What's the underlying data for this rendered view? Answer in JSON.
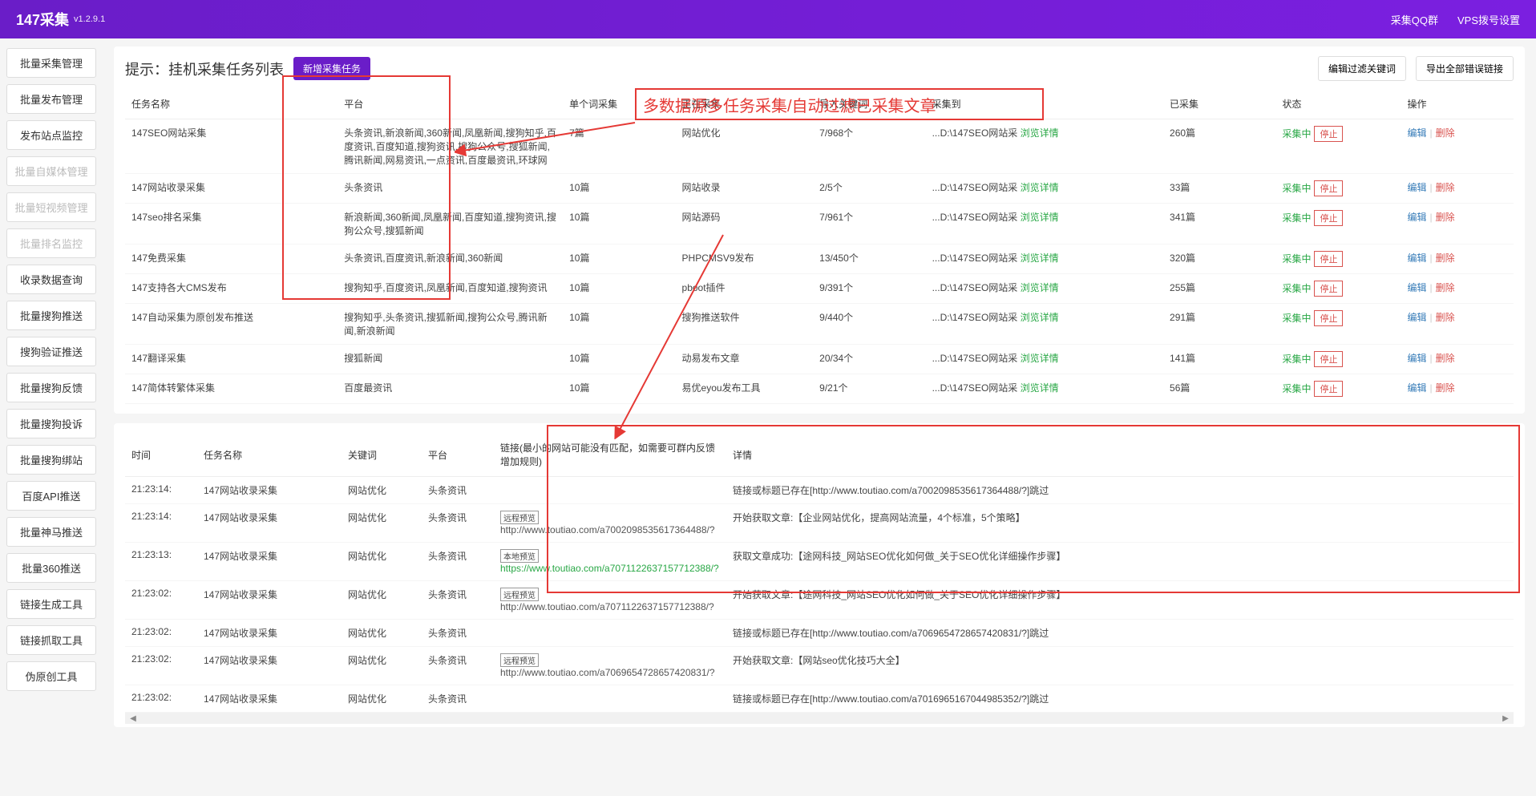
{
  "header": {
    "title": "147采集",
    "version": "v1.2.9.1",
    "links": {
      "qq": "采集QQ群",
      "vps": "VPS拨号设置"
    }
  },
  "sidebar": {
    "items": [
      {
        "label": "批量采集管理",
        "disabled": false
      },
      {
        "label": "批量发布管理",
        "disabled": false
      },
      {
        "label": "发布站点监控",
        "disabled": false
      },
      {
        "label": "批量自媒体管理",
        "disabled": true
      },
      {
        "label": "批量短视频管理",
        "disabled": true
      },
      {
        "label": "批量排名监控",
        "disabled": true
      },
      {
        "label": "收录数据查询",
        "disabled": false
      },
      {
        "label": "批量搜狗推送",
        "disabled": false
      },
      {
        "label": "搜狗验证推送",
        "disabled": false
      },
      {
        "label": "批量搜狗反馈",
        "disabled": false
      },
      {
        "label": "批量搜狗投诉",
        "disabled": false
      },
      {
        "label": "批量搜狗绑站",
        "disabled": false
      },
      {
        "label": "百度API推送",
        "disabled": false
      },
      {
        "label": "批量神马推送",
        "disabled": false
      },
      {
        "label": "批量360推送",
        "disabled": false
      },
      {
        "label": "链接生成工具",
        "disabled": false
      },
      {
        "label": "链接抓取工具",
        "disabled": false
      },
      {
        "label": "伪原创工具",
        "disabled": false
      }
    ]
  },
  "tasks": {
    "title": "提示：挂机采集任务列表",
    "add_btn": "新增采集任务",
    "filter_btn": "编辑过滤关键词",
    "export_btn": "导出全部错误链接",
    "headers": {
      "name": "任务名称",
      "platform": "平台",
      "per_word": "单个词采集",
      "collecting": "正在采集",
      "keywords": "导入关键词",
      "collect_to": "采集到",
      "collected": "已采集",
      "status": "状态",
      "action": "操作"
    },
    "detail_link": "浏览详情",
    "status_label": "采集中",
    "stop_label": "停止",
    "edit_label": "编辑",
    "delete_label": "删除",
    "rows": [
      {
        "name": "147SEO网站采集",
        "platform": "头条资讯,新浪新闻,360新闻,凤凰新闻,搜狗知乎,百度资讯,百度知道,搜狗资讯,搜狗公众号,搜狐新闻,腾讯新闻,网易资讯,一点资讯,百度最资讯,环球网",
        "per_word": "7篇",
        "collecting": "网站优化",
        "keywords": "7/968个",
        "collect_to": "...D:\\147SEO网站采",
        "collected": "260篇"
      },
      {
        "name": "147网站收录采集",
        "platform": "头条资讯",
        "per_word": "10篇",
        "collecting": "网站收录",
        "keywords": "2/5个",
        "collect_to": "...D:\\147SEO网站采",
        "collected": "33篇"
      },
      {
        "name": "147seo排名采集",
        "platform": "新浪新闻,360新闻,凤凰新闻,百度知道,搜狗资讯,搜狗公众号,搜狐新闻",
        "per_word": "10篇",
        "collecting": "网站源码",
        "keywords": "7/961个",
        "collect_to": "...D:\\147SEO网站采",
        "collected": "341篇"
      },
      {
        "name": "147免费采集",
        "platform": "头条资讯,百度资讯,新浪新闻,360新闻",
        "per_word": "10篇",
        "collecting": "PHPCMSV9发布",
        "keywords": "13/450个",
        "collect_to": "...D:\\147SEO网站采",
        "collected": "320篇"
      },
      {
        "name": "147支持各大CMS发布",
        "platform": "搜狗知乎,百度资讯,凤凰新闻,百度知道,搜狗资讯",
        "per_word": "10篇",
        "collecting": "pboot插件",
        "keywords": "9/391个",
        "collect_to": "...D:\\147SEO网站采",
        "collected": "255篇"
      },
      {
        "name": "147自动采集为原创发布推送",
        "platform": "搜狗知乎,头条资讯,搜狐新闻,搜狗公众号,腾讯新闻,新浪新闻",
        "per_word": "10篇",
        "collecting": "搜狗推送软件",
        "keywords": "9/440个",
        "collect_to": "...D:\\147SEO网站采",
        "collected": "291篇"
      },
      {
        "name": "147翻译采集",
        "platform": "搜狐新闻",
        "per_word": "10篇",
        "collecting": "动易发布文章",
        "keywords": "20/34个",
        "collect_to": "...D:\\147SEO网站采",
        "collected": "141篇"
      },
      {
        "name": "147简体转繁体采集",
        "platform": "百度最资讯",
        "per_word": "10篇",
        "collecting": "易优eyou发布工具",
        "keywords": "9/21个",
        "collect_to": "...D:\\147SEO网站采",
        "collected": "56篇"
      }
    ]
  },
  "logs": {
    "headers": {
      "time": "时间",
      "task": "任务名称",
      "keyword": "关键词",
      "platform": "平台",
      "link": "链接(最小的网站可能没有匹配，如需要可群内反馈增加规则)",
      "detail": "详情"
    },
    "badge_remote": "远程预览",
    "badge_local": "本地预览",
    "rows": [
      {
        "time": "21:23:14:",
        "task": "147网站收录采集",
        "keyword": "网站优化",
        "platform": "头条资讯",
        "badge": "",
        "url": "",
        "detail": "链接或标题已存在[http://www.toutiao.com/a7002098535617364488/?]跳过"
      },
      {
        "time": "21:23:14:",
        "task": "147网站收录采集",
        "keyword": "网站优化",
        "platform": "头条资讯",
        "badge": "remote",
        "url": "http://www.toutiao.com/a7002098535617364488/?",
        "detail": "开始获取文章:【企业网站优化，提高网站流量，4个标准，5个策略】"
      },
      {
        "time": "21:23:13:",
        "task": "147网站收录采集",
        "keyword": "网站优化",
        "platform": "头条资讯",
        "badge": "local",
        "url": "https://www.toutiao.com/a7071122637157712388/?",
        "url_green": true,
        "detail": "获取文章成功:【途网科技_网站SEO优化如何做_关于SEO优化详细操作步骤】"
      },
      {
        "time": "21:23:02:",
        "task": "147网站收录采集",
        "keyword": "网站优化",
        "platform": "头条资讯",
        "badge": "remote",
        "url": "http://www.toutiao.com/a7071122637157712388/?",
        "detail": "开始获取文章:【途网科技_网站SEO优化如何做_关于SEO优化详细操作步骤】"
      },
      {
        "time": "21:23:02:",
        "task": "147网站收录采集",
        "keyword": "网站优化",
        "platform": "头条资讯",
        "badge": "",
        "url": "",
        "detail": "链接或标题已存在[http://www.toutiao.com/a7069654728657420831/?]跳过"
      },
      {
        "time": "21:23:02:",
        "task": "147网站收录采集",
        "keyword": "网站优化",
        "platform": "头条资讯",
        "badge": "remote",
        "url": "http://www.toutiao.com/a7069654728657420831/?",
        "detail": "开始获取文章:【网站seo优化技巧大全】"
      },
      {
        "time": "21:23:02:",
        "task": "147网站收录采集",
        "keyword": "网站优化",
        "platform": "头条资讯",
        "badge": "",
        "url": "",
        "detail": "链接或标题已存在[http://www.toutiao.com/a7016965167044985352/?]跳过"
      }
    ]
  },
  "annotations": {
    "text": "多数据源多任务采集/自动过滤已采集文章"
  }
}
